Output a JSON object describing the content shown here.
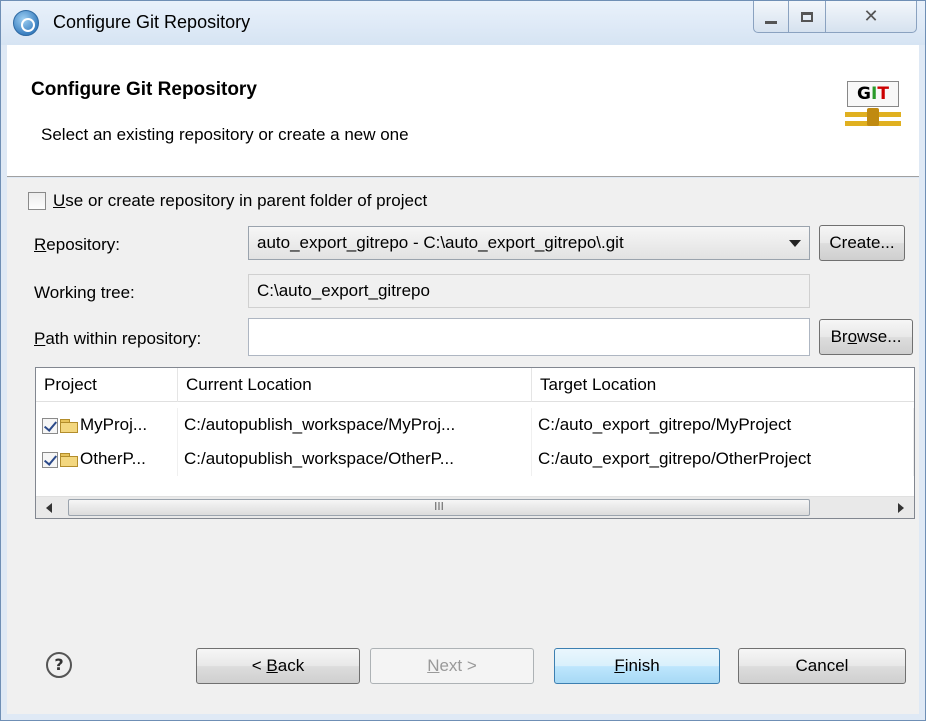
{
  "window": {
    "title": "Configure Git Repository"
  },
  "header": {
    "title": "Configure Git Repository",
    "subtitle": "Select an existing repository or create a new one",
    "logo_text": [
      "G",
      "I",
      "T"
    ]
  },
  "form": {
    "parent_folder_checkbox": {
      "label_prefix": "U",
      "label_rest": "se or create repository in parent folder of project",
      "checked": false
    },
    "repository": {
      "label_prefix": "R",
      "label_rest": "epository:",
      "value": "auto_export_gitrepo - C:\\auto_export_gitrepo\\.git",
      "create_label": "Create..."
    },
    "working_tree": {
      "label": "Working tree:",
      "value": "C:\\auto_export_gitrepo"
    },
    "path_within_repo": {
      "label_prefix": "P",
      "label_rest": "ath within repository:",
      "value": "",
      "browse_label_prefix": "Br",
      "browse_label_ul": "o",
      "browse_label_rest": "wse..."
    }
  },
  "table": {
    "columns": [
      "Project",
      "Current Location",
      "Target Location"
    ],
    "rows": [
      {
        "project": "MyProj...",
        "current": "C:/autopublish_workspace/MyProj...",
        "target": "C:/auto_export_gitrepo/MyProject",
        "checked": true
      },
      {
        "project": "OtherP...",
        "current": "C:/autopublish_workspace/OtherP...",
        "target": "C:/auto_export_gitrepo/OtherProject",
        "checked": true
      }
    ],
    "scroll_thumb_text": "III"
  },
  "footer": {
    "help_glyph": "?",
    "back_prefix": "< ",
    "back_ul": "B",
    "back_rest": "ack",
    "next_ul": "N",
    "next_rest": "ext >",
    "finish_ul": "F",
    "finish_rest": "inish",
    "cancel_label": "Cancel"
  },
  "icons": {
    "app": "eclipse-icon",
    "minimize": "minimize-icon",
    "maximize": "maximize-icon",
    "close": "close-icon",
    "folder": "folder-icon",
    "help": "help-icon",
    "dropdown": "chevron-down-icon"
  }
}
